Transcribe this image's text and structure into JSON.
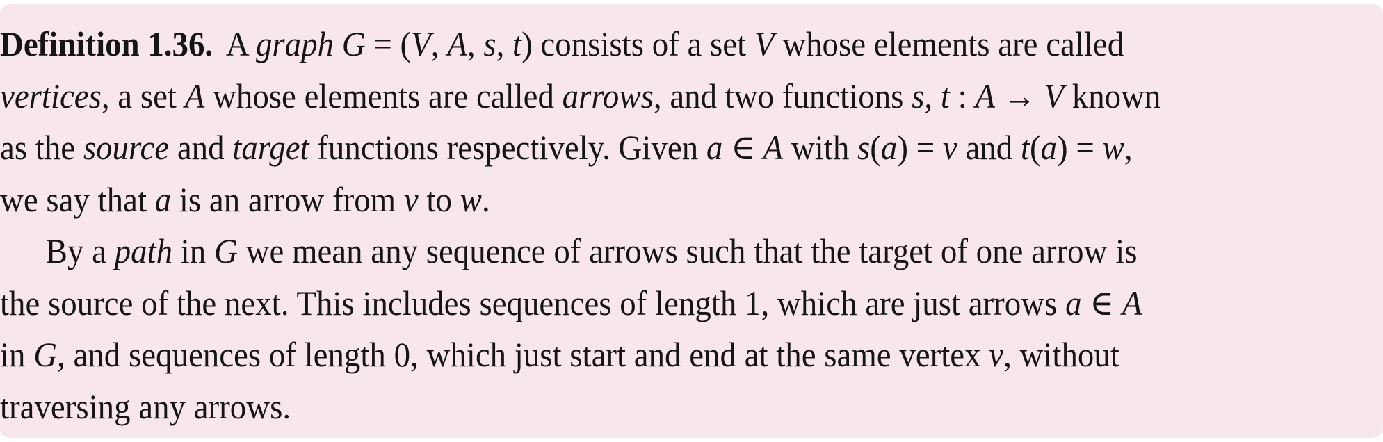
{
  "definition": {
    "heading": "Definition 1.36.",
    "lines": [
      [
        {
          "t": "A ",
          "s": "n"
        },
        {
          "t": "graph",
          "s": "i"
        },
        {
          "t": " ",
          "s": "n"
        },
        {
          "t": "G",
          "s": "i"
        },
        {
          "t": " = (",
          "s": "n"
        },
        {
          "t": "V",
          "s": "i"
        },
        {
          "t": ", ",
          "s": "n"
        },
        {
          "t": "A",
          "s": "i"
        },
        {
          "t": ", ",
          "s": "n"
        },
        {
          "t": "s",
          "s": "i"
        },
        {
          "t": ", ",
          "s": "n"
        },
        {
          "t": "t",
          "s": "i"
        },
        {
          "t": ") consists of a set ",
          "s": "n"
        },
        {
          "t": "V",
          "s": "i"
        },
        {
          "t": " whose elements are called",
          "s": "n"
        }
      ],
      [
        {
          "t": "vertices",
          "s": "i"
        },
        {
          "t": ", a set ",
          "s": "n"
        },
        {
          "t": "A",
          "s": "i"
        },
        {
          "t": " whose elements are called ",
          "s": "n"
        },
        {
          "t": "arrows",
          "s": "i"
        },
        {
          "t": ", and two functions ",
          "s": "n"
        },
        {
          "t": "s",
          "s": "i"
        },
        {
          "t": ", ",
          "s": "n"
        },
        {
          "t": "t",
          "s": "i"
        },
        {
          "t": " : ",
          "s": "n"
        },
        {
          "t": "A",
          "s": "i"
        },
        {
          "t": " → ",
          "s": "n"
        },
        {
          "t": "V",
          "s": "i"
        },
        {
          "t": " known",
          "s": "n"
        }
      ],
      [
        {
          "t": "as the ",
          "s": "n"
        },
        {
          "t": "source",
          "s": "i"
        },
        {
          "t": " and ",
          "s": "n"
        },
        {
          "t": "target",
          "s": "i"
        },
        {
          "t": " functions respectively.  Given ",
          "s": "n"
        },
        {
          "t": "a",
          "s": "i"
        },
        {
          "t": " ∈ ",
          "s": "n"
        },
        {
          "t": "A",
          "s": "i"
        },
        {
          "t": " with ",
          "s": "n"
        },
        {
          "t": "s",
          "s": "i"
        },
        {
          "t": "(",
          "s": "n"
        },
        {
          "t": "a",
          "s": "i"
        },
        {
          "t": ") = ",
          "s": "n"
        },
        {
          "t": "v",
          "s": "i"
        },
        {
          "t": " and ",
          "s": "n"
        },
        {
          "t": "t",
          "s": "i"
        },
        {
          "t": "(",
          "s": "n"
        },
        {
          "t": "a",
          "s": "i"
        },
        {
          "t": ") = ",
          "s": "n"
        },
        {
          "t": "w",
          "s": "i"
        },
        {
          "t": ",",
          "s": "n"
        }
      ],
      [
        {
          "t": "we say that ",
          "s": "n"
        },
        {
          "t": "a",
          "s": "i"
        },
        {
          "t": " is an arrow from ",
          "s": "n"
        },
        {
          "t": "v",
          "s": "i"
        },
        {
          "t": " to ",
          "s": "n"
        },
        {
          "t": "w",
          "s": "i"
        },
        {
          "t": ".",
          "s": "n"
        }
      ],
      [
        {
          "t": "By a ",
          "s": "n"
        },
        {
          "t": "path",
          "s": "i"
        },
        {
          "t": " in ",
          "s": "n"
        },
        {
          "t": "G",
          "s": "i"
        },
        {
          "t": " we mean any sequence of arrows such that the target of one arrow is",
          "s": "n"
        }
      ],
      [
        {
          "t": "the source of the next.  This includes sequences of length 1, which are just arrows ",
          "s": "n"
        },
        {
          "t": "a",
          "s": "i"
        },
        {
          "t": " ∈ ",
          "s": "n"
        },
        {
          "t": "A",
          "s": "i"
        }
      ],
      [
        {
          "t": "in ",
          "s": "n"
        },
        {
          "t": "G",
          "s": "i"
        },
        {
          "t": ", and sequences of length 0, which just start and end at the same vertex ",
          "s": "n"
        },
        {
          "t": "v",
          "s": "i"
        },
        {
          "t": ", without",
          "s": "n"
        }
      ],
      [
        {
          "t": "traversing any arrows.",
          "s": "n"
        }
      ]
    ]
  }
}
